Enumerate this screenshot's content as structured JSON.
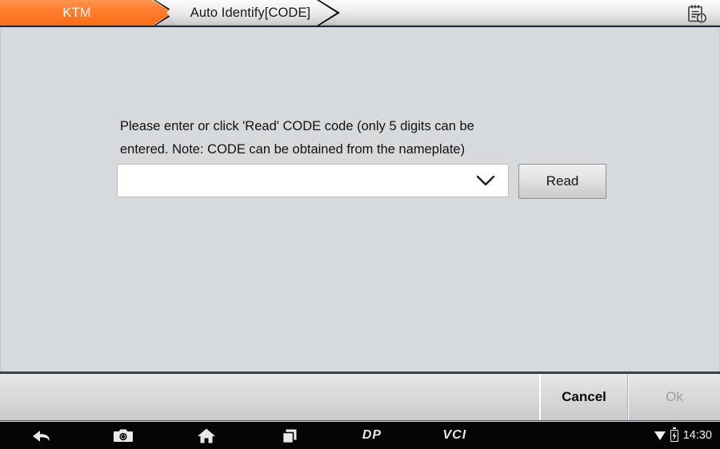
{
  "window": {
    "title": "Auto Identify[CODE]"
  },
  "tabs": [
    {
      "label": "KTM",
      "active": true
    },
    {
      "label": "Auto Identify[CODE]",
      "active": false
    }
  ],
  "header": {
    "report_icon": "report-note-icon"
  },
  "main": {
    "prompt_line1": "Please enter or click 'Read' CODE code (only 5 digits can be",
    "prompt_line2": "entered. Note: CODE can be obtained from the nameplate)",
    "code_input": {
      "value": "",
      "placeholder": ""
    },
    "dropdown_icon": "chevron-down-icon",
    "read_label": "Read"
  },
  "footer": {
    "cancel_label": "Cancel",
    "ok_label": "Ok",
    "ok_enabled": false
  },
  "navbar": {
    "items": [
      {
        "icon": "back-arrow-icon",
        "label": ""
      },
      {
        "icon": "camera-icon",
        "label": ""
      },
      {
        "icon": "home-icon",
        "label": ""
      },
      {
        "icon": "recents-icon",
        "label": ""
      },
      {
        "icon": "dp-logo-icon",
        "label": "DP"
      },
      {
        "icon": "vci-logo-icon",
        "label": "VCI"
      }
    ],
    "status": {
      "wifi_icon": "wifi-icon",
      "battery_icon": "battery-charging-icon",
      "time": "14:30"
    }
  },
  "colors": {
    "accent_orange": "#fb7522",
    "content_bg": "#d7dadd",
    "navbar_bg": "#050505",
    "disabled_text": "#9b9ea1"
  }
}
